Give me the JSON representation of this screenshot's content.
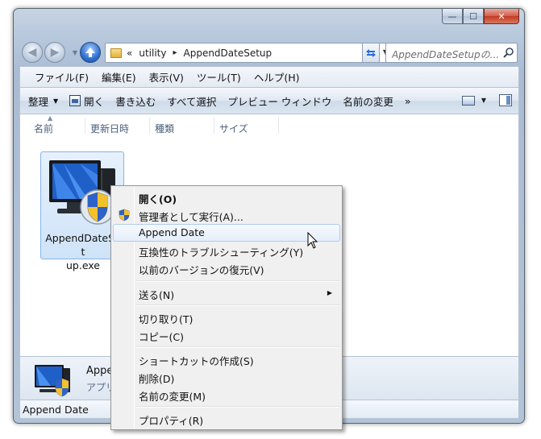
{
  "window": {
    "caption_buttons": {
      "minimize": "—",
      "maximize": "☐",
      "close": "✕"
    },
    "colors": {
      "accent": "#2e6fcf",
      "selection": "#cfe3f8"
    }
  },
  "nav": {
    "back_glyph": "◀",
    "forward_glyph": "▶",
    "address_prefix": "«",
    "breadcrumb": [
      "utility",
      "AppendDateSetup"
    ],
    "breadcrumb_sep": "▸",
    "search_placeholder": "AppendDateSetupの..."
  },
  "menubar": {
    "items": [
      "ファイル(F)",
      "編集(E)",
      "表示(V)",
      "ツール(T)",
      "ヘルプ(H)"
    ]
  },
  "toolbar": {
    "organize": "整理",
    "open": "開く",
    "burn": "書き込む",
    "select_all": "すべて選択",
    "preview": "プレビュー ウィンドウ",
    "rename": "名前の変更",
    "more": "»"
  },
  "columns": [
    "名前",
    "更新日時",
    "種類",
    "サイズ"
  ],
  "file": {
    "name_line1": "AppendDateSet",
    "name_line2": "up.exe"
  },
  "details": {
    "name": "Append",
    "type": "アプリ"
  },
  "status": {
    "text": "Append Date"
  },
  "context_menu": {
    "items": [
      {
        "label": "開く(O)",
        "bold": true
      },
      {
        "label": "管理者として実行(A)...",
        "icon": "shield-icon"
      },
      {
        "label": "Append Date",
        "hover": true
      },
      {
        "label": "互換性のトラブルシューティング(Y)"
      },
      {
        "label": "以前のバージョンの復元(V)"
      },
      {
        "label": "送る(N)",
        "submenu": true
      },
      {
        "label": "切り取り(T)"
      },
      {
        "label": "コピー(C)"
      },
      {
        "label": "ショートカットの作成(S)"
      },
      {
        "label": "削除(D)"
      },
      {
        "label": "名前の変更(M)"
      },
      {
        "label": "プロパティ(R)"
      }
    ]
  }
}
